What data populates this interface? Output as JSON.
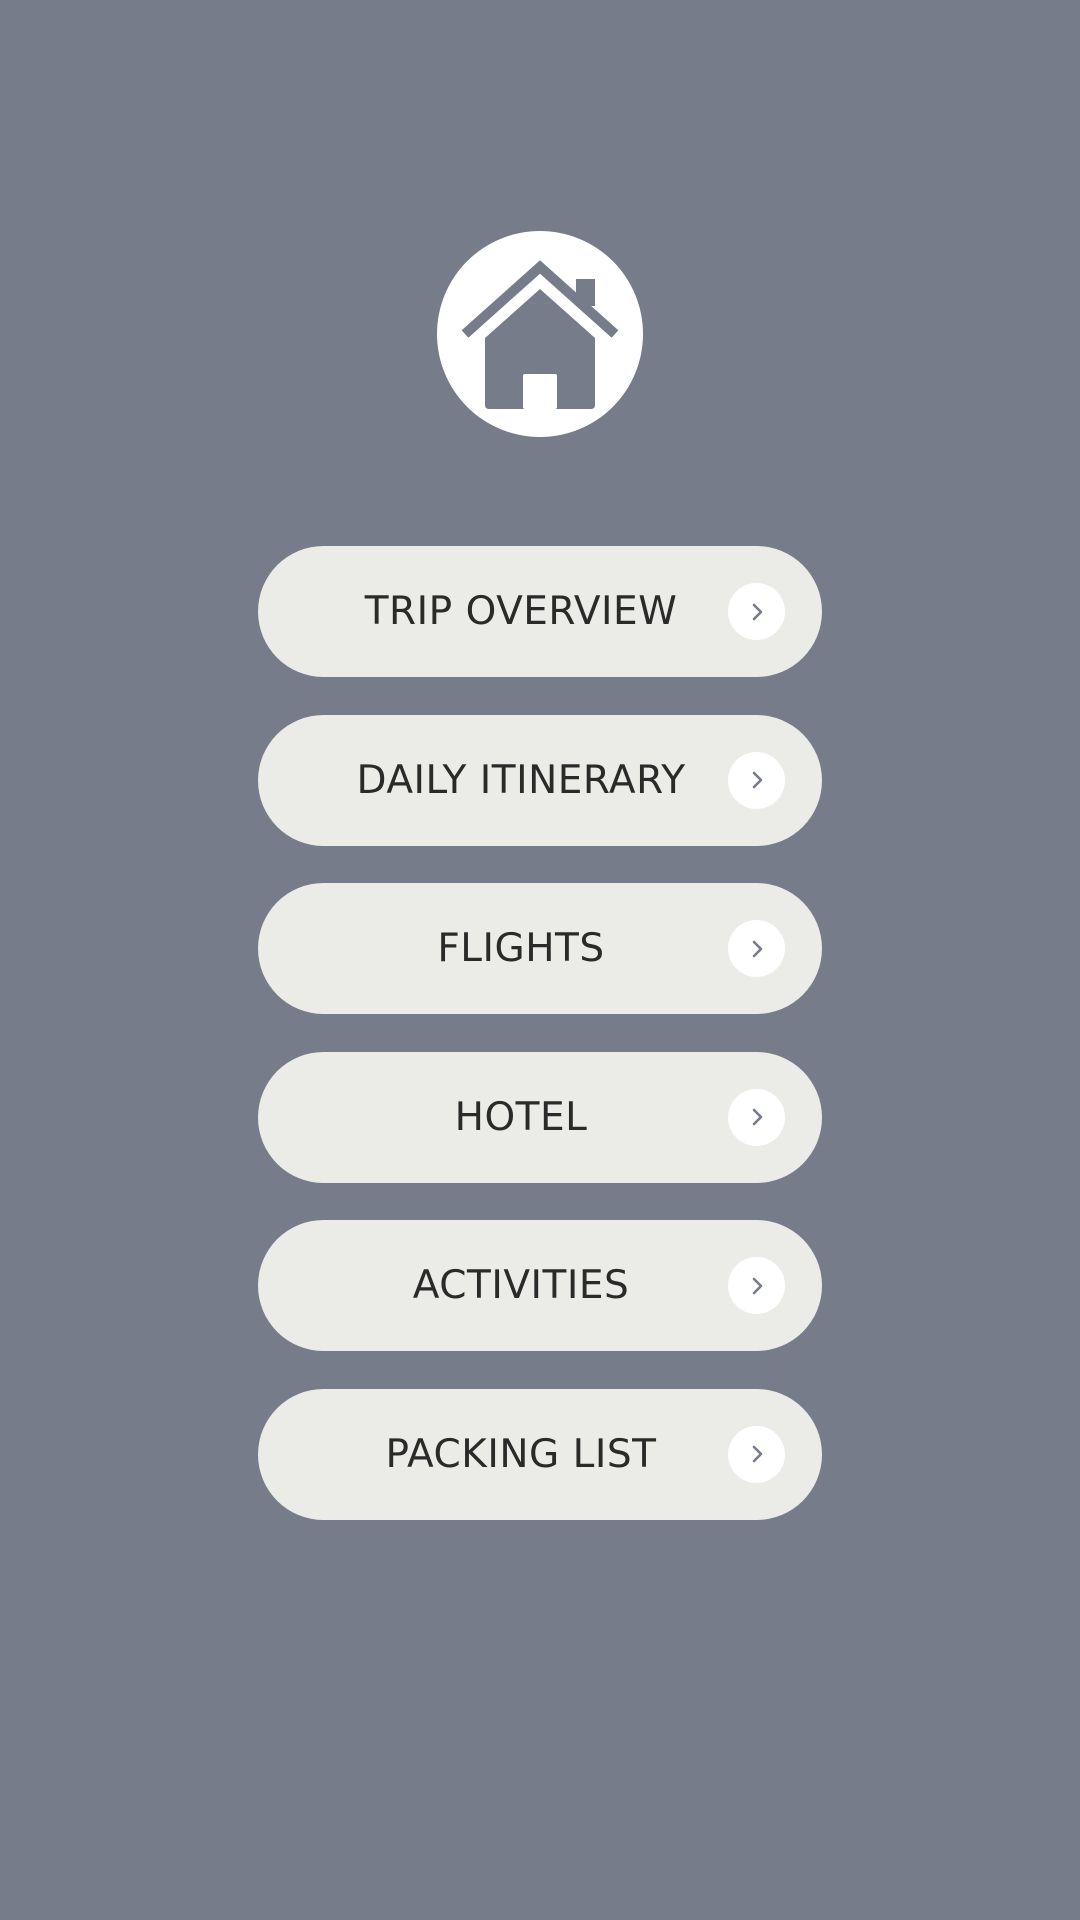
{
  "colors": {
    "background": "#777c8a",
    "button_bg": "#ebebe7",
    "text": "#2a2a2a",
    "icon_fill": "#ffffff",
    "chevron": "#777c8a"
  },
  "header": {
    "icon": "home-icon"
  },
  "menu": {
    "items": [
      {
        "label": "TRIP OVERVIEW",
        "icon": "chevron-right-icon"
      },
      {
        "label": "DAILY ITINERARY",
        "icon": "chevron-right-icon"
      },
      {
        "label": "FLIGHTS",
        "icon": "chevron-right-icon"
      },
      {
        "label": "HOTEL",
        "icon": "chevron-right-icon"
      },
      {
        "label": "ACTIVITIES",
        "icon": "chevron-right-icon"
      },
      {
        "label": "PACKING LIST",
        "icon": "chevron-right-icon"
      }
    ]
  }
}
